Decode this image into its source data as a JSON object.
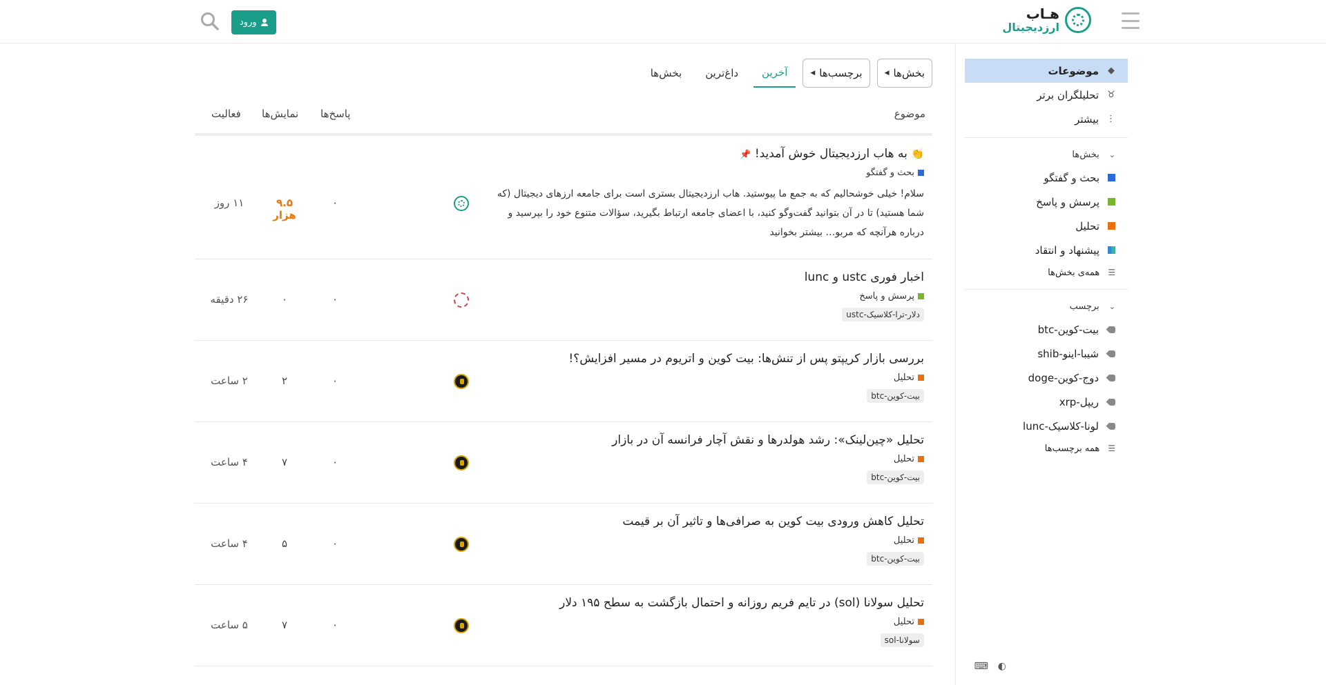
{
  "header": {
    "logo_line1": "هـاب",
    "logo_line2": "ارزدیجیتال",
    "login_label": "ورود"
  },
  "sidebar": {
    "nav": [
      {
        "label": "موضوعات",
        "icon": "layers-icon"
      },
      {
        "label": "تحلیلگران برتر",
        "icon": "medal-icon"
      },
      {
        "label": "بیشتر",
        "icon": "more-vertical-icon"
      }
    ],
    "sections_heading": "بخش‌ها",
    "sections": [
      {
        "label": "بحث و گفتگو",
        "color": "#2d6ad6"
      },
      {
        "label": "پرسش و پاسخ",
        "color": "#78b62f"
      },
      {
        "label": "تحلیل",
        "color": "#e8700f"
      },
      {
        "label": "پیشنهاد و انتقاد",
        "color": "#2e8ad6"
      }
    ],
    "all_sections": "همه‌ی بخش‌ها",
    "tags_heading": "برچسب",
    "tags": [
      "بیت-کوین-btc",
      "شیبا-اینو-shib",
      "دوج-کوین-doge",
      "ریپل-xrp",
      "لونا-کلاسیک-lunc"
    ],
    "all_tags": "همه برچسب‌ها"
  },
  "nav": {
    "sections_btn": "بخش‌ها",
    "tags_btn": "برچسب‌ها",
    "latest": "آخرین",
    "hot": "داغ‌ترین",
    "categories": "بخش‌ها"
  },
  "table": {
    "col_topic": "موضوع",
    "col_replies": "پاسخ‌ها",
    "col_views": "نمایش‌ها",
    "col_activity": "فعالیت"
  },
  "topics": [
    {
      "title": "به هاب ارزدیجیتال خوش آمدید!",
      "category": "بحث و گفتگو",
      "category_color": "#2d6ad6",
      "excerpt": "سلام! خیلی خوشحالیم که به جمع ما پیوستید. هاب ارزدیجیتال بستری است برای جامعه ارزهای دیجیتال (که شما هستید) تا در آن بتوانید گفت‌وگو کنید، با اعضای جامعه ارتباط بگیرید، سؤالات متنوع خود را بپرسید و درباره هرآنچه که مربو… بیشتر بخوانید",
      "replies": "۰",
      "views": "۹.۵ هزار",
      "activity": "۱۱ روز"
    },
    {
      "title": "اخبار فوری ustc و lunc",
      "category": "پرسش و پاسخ",
      "category_color": "#78b62f",
      "tag": "دلار-ترا-کلاسیک-ustc",
      "replies": "۰",
      "views": "۰",
      "activity": "۲۶ دقیقه"
    },
    {
      "title": "بررسی بازار کریپتو پس از تنش‌ها: بیت کوین و اتریوم در مسیر افزایش؟!",
      "category": "تحلیل",
      "category_color": "#e8700f",
      "tag": "بیت-کوین-btc",
      "replies": "۰",
      "views": "۲",
      "activity": "۲ ساعت"
    },
    {
      "title": "تحلیل «چین‌لینک»: رشد هولدرها و نقش آچار فرانسه آن در بازار",
      "category": "تحلیل",
      "category_color": "#e8700f",
      "tag": "بیت-کوین-btc",
      "replies": "۰",
      "views": "۷",
      "activity": "۴ ساعت"
    },
    {
      "title": "تحلیل کاهش ورودی بیت کوین به صرافی‌ها و تاثیر آن بر قیمت",
      "category": "تحلیل",
      "category_color": "#e8700f",
      "tag": "بیت-کوین-btc",
      "replies": "۰",
      "views": "۵",
      "activity": "۴ ساعت"
    },
    {
      "title": "تحلیل سولانا (sol) در تایم فریم روزانه و احتمال بازگشت به سطح ۱۹۵ دلار",
      "category": "تحلیل",
      "category_color": "#e8700f",
      "tag": "سولانا-sol",
      "replies": "۰",
      "views": "۷",
      "activity": "۵ ساعت"
    }
  ]
}
